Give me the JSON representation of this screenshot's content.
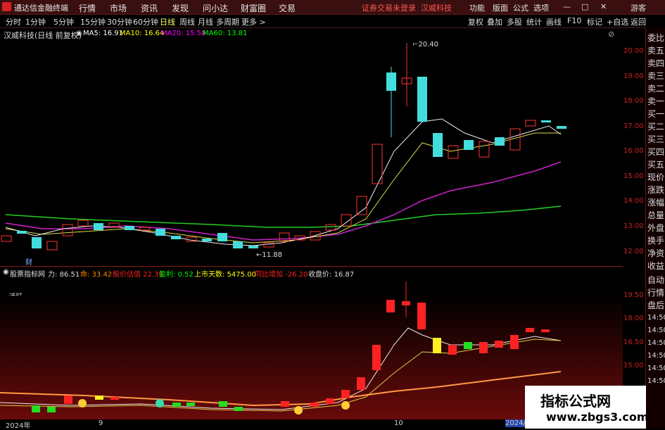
{
  "app": {
    "title": "通达信金融终端"
  },
  "menu": [
    "行情",
    "市场",
    "资讯",
    "发现",
    "问小达",
    "财富圈",
    "交易"
  ],
  "login_notice": "证券交易未登录",
  "header_stock": "汉威科技",
  "right_menu": [
    "功能",
    "版面",
    "公式",
    "选项"
  ],
  "window_buttons": [
    "—",
    "□",
    "✕",
    "游客"
  ],
  "periods": [
    "分时",
    "1分钟",
    "5分钟",
    "15分钟",
    "30分钟",
    "60分钟",
    "日线",
    "周线",
    "月线",
    "多周期",
    "更多 >"
  ],
  "active_period": "日线",
  "tools": [
    "复权",
    "叠加",
    "多股",
    "统计",
    "画线",
    "F10",
    "标记",
    "+自选",
    "返回"
  ],
  "stock": {
    "name": "汉威科技",
    "mode": "(日线 前复权)"
  },
  "ma": [
    {
      "label": "MA5: 16.91",
      "color": "#ffffff"
    },
    {
      "label": "MA10: 16.64",
      "color": "#ffff00"
    },
    {
      "label": "MA20: 15.58",
      "color": "#ff00ff"
    },
    {
      "label": "MA60: 13.81",
      "color": "#00ff00"
    }
  ],
  "price_axis": [
    "20.00",
    "19.00",
    "18.00",
    "17.00",
    "16.00",
    "15.00",
    "14.00",
    "13.00",
    "12.00"
  ],
  "max_label": "20.40",
  "min_label": "11.88",
  "cai_label": "财",
  "indicator": {
    "name": "股票指标网",
    "items": [
      {
        "k": "力:",
        "v": "86.51",
        "color": "#dddddd"
      },
      {
        "k": "命:",
        "v": "33.42",
        "color": "#ff8800"
      },
      {
        "k": "股价估值",
        "v": "22.39",
        "color": "#ff2222"
      },
      {
        "k": "盈利:",
        "v": "0.52",
        "color": "#00ff00"
      },
      {
        "k": "上市天数:",
        "v": "5475.00",
        "color": "#ffff00"
      },
      {
        "k": "同比增加",
        "v": "-26.20",
        "color": "#ff2222"
      },
      {
        "k": "收盘价:",
        "v": "16.87",
        "color": "#dddddd"
      }
    ],
    "active_label": "←活跃"
  },
  "ind_axis": [
    "19.50",
    "18.00",
    "16.50",
    "15.00"
  ],
  "sidebar": [
    "委比",
    "卖五",
    "卖四",
    "卖三",
    "卖二",
    "卖一",
    "买一",
    "买二",
    "买三",
    "买四",
    "买五",
    "现价",
    "涨跌",
    "涨幅",
    "总量",
    "外盘",
    "换手",
    "净资",
    "收益",
    "自动",
    "行情",
    "盘后",
    "14:50",
    "14:50",
    "14:50",
    "14:50",
    "14:50",
    "14:50"
  ],
  "dates": [
    "2024年",
    "9",
    "10",
    "2024/1"
  ],
  "watermark": {
    "line1": "指标公式网",
    "line2": "www.zbgs3.com"
  }
}
